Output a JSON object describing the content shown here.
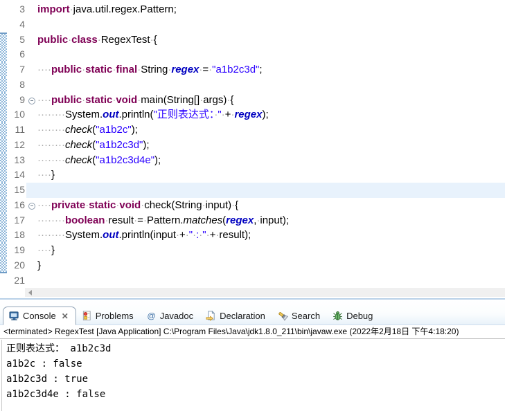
{
  "colors": {
    "keyword": "#7F0055",
    "string": "#2A00FF",
    "static_field": "#0000C0",
    "line_number": "#6E6E6E",
    "current_line_highlight": "#E8F2FC",
    "range_indicator": "#8FB7D9",
    "tabbar_tint": "#E9F2FA"
  },
  "editor": {
    "range_start": 5,
    "range_end": 20,
    "lines": [
      {
        "n": 3,
        "fold": false,
        "hl": false,
        "seg": [
          [
            "k",
            "import"
          ],
          [
            "w",
            "·"
          ],
          [
            "p",
            "java.util.regex.Pattern;"
          ]
        ]
      },
      {
        "n": 4,
        "fold": false,
        "hl": false,
        "seg": []
      },
      {
        "n": 5,
        "fold": false,
        "hl": false,
        "seg": [
          [
            "k",
            "public"
          ],
          [
            "w",
            "·"
          ],
          [
            "k",
            "class"
          ],
          [
            "w",
            "·"
          ],
          [
            "p",
            "RegexTest"
          ],
          [
            "w",
            "·"
          ],
          [
            "p",
            "{"
          ]
        ]
      },
      {
        "n": 6,
        "fold": false,
        "hl": false,
        "seg": []
      },
      {
        "n": 7,
        "fold": false,
        "hl": false,
        "seg": [
          [
            "w",
            "····"
          ],
          [
            "k",
            "public"
          ],
          [
            "w",
            "·"
          ],
          [
            "k",
            "static"
          ],
          [
            "w",
            "·"
          ],
          [
            "k",
            "final"
          ],
          [
            "w",
            "·"
          ],
          [
            "p",
            "String"
          ],
          [
            "w",
            "·"
          ],
          [
            "f",
            "regex"
          ],
          [
            "w",
            "·"
          ],
          [
            "p",
            "="
          ],
          [
            "w",
            "·"
          ],
          [
            "s",
            "\"a1b2c3d\""
          ],
          [
            "p",
            ";"
          ]
        ]
      },
      {
        "n": 8,
        "fold": false,
        "hl": false,
        "seg": []
      },
      {
        "n": 9,
        "fold": true,
        "hl": false,
        "seg": [
          [
            "w",
            "····"
          ],
          [
            "k",
            "public"
          ],
          [
            "w",
            "·"
          ],
          [
            "k",
            "static"
          ],
          [
            "w",
            "·"
          ],
          [
            "k",
            "void"
          ],
          [
            "w",
            "·"
          ],
          [
            "p",
            "main(String[]"
          ],
          [
            "w",
            "·"
          ],
          [
            "p",
            "args)"
          ],
          [
            "w",
            "·"
          ],
          [
            "p",
            "{"
          ]
        ]
      },
      {
        "n": 10,
        "fold": false,
        "hl": false,
        "seg": [
          [
            "w",
            "········"
          ],
          [
            "p",
            "System."
          ],
          [
            "f",
            "out"
          ],
          [
            "p",
            ".println("
          ],
          [
            "s",
            "\"正则表达式："
          ],
          [
            "w",
            "·"
          ],
          [
            "s",
            "\""
          ],
          [
            "w",
            "·"
          ],
          [
            "p",
            "+"
          ],
          [
            "w",
            "·"
          ],
          [
            "f",
            "regex"
          ],
          [
            "p",
            ");"
          ]
        ]
      },
      {
        "n": 11,
        "fold": false,
        "hl": false,
        "seg": [
          [
            "w",
            "········"
          ],
          [
            "m",
            "check"
          ],
          [
            "p",
            "("
          ],
          [
            "s",
            "\"a1b2c\""
          ],
          [
            "p",
            ");"
          ]
        ]
      },
      {
        "n": 12,
        "fold": false,
        "hl": false,
        "seg": [
          [
            "w",
            "········"
          ],
          [
            "m",
            "check"
          ],
          [
            "p",
            "("
          ],
          [
            "s",
            "\"a1b2c3d\""
          ],
          [
            "p",
            ");"
          ]
        ]
      },
      {
        "n": 13,
        "fold": false,
        "hl": false,
        "seg": [
          [
            "w",
            "········"
          ],
          [
            "m",
            "check"
          ],
          [
            "p",
            "("
          ],
          [
            "s",
            "\"a1b2c3d4e\""
          ],
          [
            "p",
            ");"
          ]
        ]
      },
      {
        "n": 14,
        "fold": false,
        "hl": false,
        "seg": [
          [
            "w",
            "····"
          ],
          [
            "p",
            "}"
          ]
        ]
      },
      {
        "n": 15,
        "fold": false,
        "hl": true,
        "seg": []
      },
      {
        "n": 16,
        "fold": true,
        "hl": false,
        "seg": [
          [
            "w",
            "····"
          ],
          [
            "k",
            "private"
          ],
          [
            "w",
            "·"
          ],
          [
            "k",
            "static"
          ],
          [
            "w",
            "·"
          ],
          [
            "k",
            "void"
          ],
          [
            "w",
            "·"
          ],
          [
            "p",
            "check(String"
          ],
          [
            "w",
            "·"
          ],
          [
            "p",
            "input)"
          ],
          [
            "w",
            "·"
          ],
          [
            "p",
            "{"
          ]
        ]
      },
      {
        "n": 17,
        "fold": false,
        "hl": false,
        "seg": [
          [
            "w",
            "········"
          ],
          [
            "k",
            "boolean"
          ],
          [
            "w",
            "·"
          ],
          [
            "p",
            "result"
          ],
          [
            "w",
            "·"
          ],
          [
            "p",
            "="
          ],
          [
            "w",
            "·"
          ],
          [
            "p",
            "Pattern."
          ],
          [
            "m",
            "matches"
          ],
          [
            "p",
            "("
          ],
          [
            "f",
            "regex"
          ],
          [
            "p",
            ","
          ],
          [
            "w",
            "·"
          ],
          [
            "p",
            "input);"
          ]
        ]
      },
      {
        "n": 18,
        "fold": false,
        "hl": false,
        "seg": [
          [
            "w",
            "········"
          ],
          [
            "p",
            "System."
          ],
          [
            "f",
            "out"
          ],
          [
            "p",
            ".println(input"
          ],
          [
            "w",
            "·"
          ],
          [
            "p",
            "+"
          ],
          [
            "w",
            "·"
          ],
          [
            "s",
            "\""
          ],
          [
            "w",
            "·"
          ],
          [
            "s",
            ":"
          ],
          [
            "w",
            "·"
          ],
          [
            "s",
            "\""
          ],
          [
            "w",
            "·"
          ],
          [
            "p",
            "+"
          ],
          [
            "w",
            "·"
          ],
          [
            "p",
            "result);"
          ]
        ]
      },
      {
        "n": 19,
        "fold": false,
        "hl": false,
        "seg": [
          [
            "w",
            "····"
          ],
          [
            "p",
            "}"
          ]
        ]
      },
      {
        "n": 20,
        "fold": false,
        "hl": false,
        "seg": [
          [
            "p",
            "}"
          ]
        ]
      },
      {
        "n": 21,
        "fold": false,
        "hl": false,
        "seg": []
      }
    ]
  },
  "console": {
    "tabs": [
      {
        "label": "Console",
        "icon": "console-icon",
        "selected": true,
        "close_icon": "✕"
      },
      {
        "label": "Problems",
        "icon": "problems-icon",
        "selected": false
      },
      {
        "label": "Javadoc",
        "icon": "javadoc-icon",
        "selected": false
      },
      {
        "label": "Declaration",
        "icon": "declaration-icon",
        "selected": false
      },
      {
        "label": "Search",
        "icon": "search-icon",
        "selected": false
      },
      {
        "label": "Debug",
        "icon": "debug-icon",
        "selected": false
      }
    ],
    "status": "<terminated> RegexTest [Java Application] C:\\Program Files\\Java\\jdk1.8.0_211\\bin\\javaw.exe (2022年2月18日 下午4:18:20)",
    "output": [
      "正则表达式： a1b2c3d",
      "a1b2c : false",
      "a1b2c3d : true",
      "a1b2c3d4e : false"
    ]
  }
}
